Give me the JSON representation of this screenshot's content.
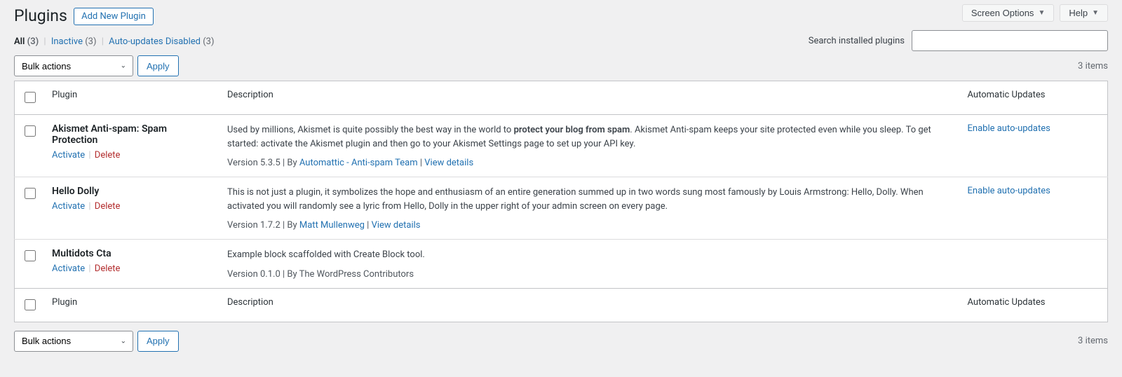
{
  "topbar": {
    "screen_options": "Screen Options",
    "help": "Help"
  },
  "header": {
    "title": "Plugins",
    "add_new": "Add New Plugin"
  },
  "filters": {
    "all_label": "All",
    "all_count": "(3)",
    "inactive_label": "Inactive",
    "inactive_count": "(3)",
    "auto_disabled_label": "Auto-updates Disabled",
    "auto_disabled_count": "(3)"
  },
  "search": {
    "label": "Search installed plugins"
  },
  "bulk": {
    "placeholder": "Bulk actions",
    "apply": "Apply"
  },
  "count": "3 items",
  "columns": {
    "plugin": "Plugin",
    "description": "Description",
    "auto": "Automatic Updates"
  },
  "plugins": [
    {
      "name": "Akismet Anti-spam: Spam Protection",
      "activate": "Activate",
      "delete": "Delete",
      "desc_pre": "Used by millions, Akismet is quite possibly the best way in the world to ",
      "desc_bold": "protect your blog from spam",
      "desc_post": ". Akismet Anti-spam keeps your site protected even while you sleep. To get started: activate the Akismet plugin and then go to your Akismet Settings page to set up your API key.",
      "version": "Version 5.3.5",
      "by": "By ",
      "author": "Automattic - Anti-spam Team",
      "view": "View details",
      "auto": "Enable auto-updates"
    },
    {
      "name": "Hello Dolly",
      "activate": "Activate",
      "delete": "Delete",
      "desc_pre": "This is not just a plugin, it symbolizes the hope and enthusiasm of an entire generation summed up in two words sung most famously by Louis Armstrong: Hello, Dolly. When activated you will randomly see a lyric from Hello, Dolly in the upper right of your admin screen on every page.",
      "desc_bold": "",
      "desc_post": "",
      "version": "Version 1.7.2",
      "by": "By ",
      "author": "Matt Mullenweg",
      "view": "View details",
      "auto": "Enable auto-updates"
    },
    {
      "name": "Multidots Cta",
      "activate": "Activate",
      "delete": "Delete",
      "desc_pre": "Example block scaffolded with Create Block tool.",
      "desc_bold": "",
      "desc_post": "",
      "version": "Version 0.1.0",
      "by": "By The WordPress Contributors",
      "author": "",
      "view": "",
      "auto": ""
    }
  ]
}
